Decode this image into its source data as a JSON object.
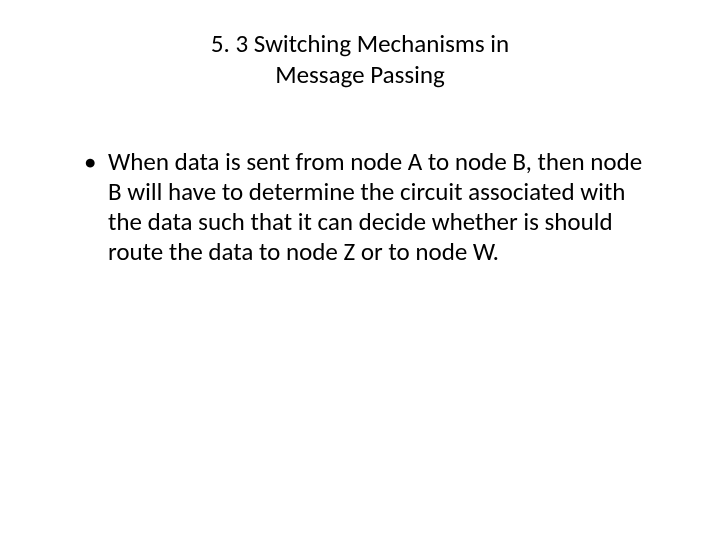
{
  "slide": {
    "title_line1": "5. 3 Switching Mechanisms in",
    "title_line2": "Message Passing",
    "bullets": [
      "When data is sent from node A to node B, then node B will have to determine the circuit associated with the data such that it can decide whether is should route the data to node Z or to node W."
    ]
  }
}
